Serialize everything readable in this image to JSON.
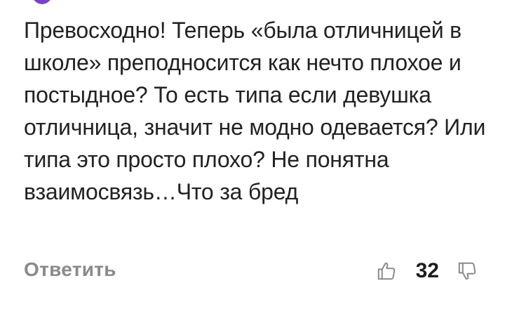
{
  "comment": {
    "text": "Превосходно! Теперь «была отличницей в школе» преподносится как нечто плохое и постыдное? То есть типа если девушка отличница, значит не модно одевается? Или типа это просто плохо? Не понятна взаимосвязь…Что за бред",
    "reply_label": "Ответить",
    "like_count": "32",
    "like_icon": "thumbs-up-icon",
    "dislike_icon": "thumbs-down-icon",
    "avatar_color": "#7a3fd1"
  }
}
